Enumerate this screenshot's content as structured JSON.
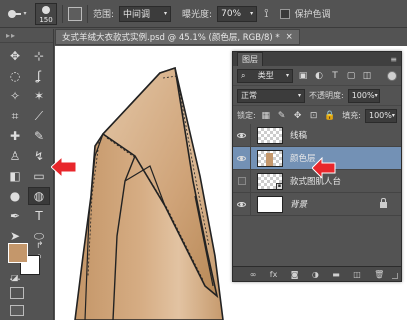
{
  "options_bar": {
    "brush_size": "150",
    "range_label": "范围:",
    "range_value": "中间调",
    "exposure_label": "曝光度:",
    "exposure_value": "70%",
    "protect_tones_label": "保护色调"
  },
  "document": {
    "tab_title": "女式羊绒大衣款式实例.psd @ 45.1% (颜色层, RGB/8) *",
    "close_symbol": "×"
  },
  "toolbar": {
    "grip": "▸▸",
    "tools": [
      {
        "name": "move-tool-icon",
        "glyph": "✥"
      },
      {
        "name": "artboard-tool-icon",
        "glyph": "⊹"
      },
      {
        "name": "marquee-tool-icon",
        "glyph": "◌"
      },
      {
        "name": "lasso-tool-icon",
        "glyph": "ʆ"
      },
      {
        "name": "quick-select-tool-icon",
        "glyph": "✧"
      },
      {
        "name": "magic-wand-tool-icon",
        "glyph": "✶"
      },
      {
        "name": "crop-tool-icon",
        "glyph": "⌗"
      },
      {
        "name": "eyedropper-tool-icon",
        "glyph": "⟋"
      },
      {
        "name": "healing-brush-tool-icon",
        "glyph": "✚"
      },
      {
        "name": "brush-tool-icon",
        "glyph": "✎"
      },
      {
        "name": "clone-stamp-tool-icon",
        "glyph": "♙"
      },
      {
        "name": "history-brush-tool-icon",
        "glyph": "↯"
      },
      {
        "name": "eraser-tool-icon",
        "glyph": "◧"
      },
      {
        "name": "gradient-tool-icon",
        "glyph": "▭"
      },
      {
        "name": "blur-tool-icon",
        "glyph": "●"
      },
      {
        "name": "dodge-tool-icon",
        "glyph": "◍"
      },
      {
        "name": "pen-tool-icon",
        "glyph": "✒"
      },
      {
        "name": "type-tool-icon",
        "glyph": "T"
      },
      {
        "name": "path-select-tool-icon",
        "glyph": "➤"
      },
      {
        "name": "ellipse-tool-icon",
        "glyph": "⬭"
      },
      {
        "name": "hand-tool-icon",
        "glyph": "✋"
      },
      {
        "name": "zoom-tool-icon",
        "glyph": "⌕"
      }
    ],
    "more_tools": "…",
    "foreground_color": "#c4976b",
    "background_color": "#ffffff"
  },
  "layers_panel": {
    "tab_label": "图层",
    "menu_glyph": "≡",
    "filter_label": "类型",
    "blend_mode": "正常",
    "opacity_label": "不透明度:",
    "opacity_value": "100%",
    "lock_label": "锁定:",
    "fill_label": "填充:",
    "fill_value": "100%",
    "layers": [
      {
        "name": "线稿",
        "visible": true,
        "selected": false
      },
      {
        "name": "颜色层",
        "visible": true,
        "selected": true
      },
      {
        "name": "款式图肌人台",
        "visible": false,
        "selected": false
      },
      {
        "name": "背景",
        "visible": true,
        "selected": false,
        "locked": true
      }
    ],
    "footer_icons": [
      "link-icon",
      "fx-icon",
      "mask-icon",
      "adjustment-icon",
      "group-icon",
      "new-layer-icon",
      "delete-icon"
    ]
  },
  "colors": {
    "coat_fill": "#c4976b",
    "coat_highlight": "#e0c2a0",
    "panel_selected": "#7391b5",
    "annotation_red": "#e8262b"
  }
}
